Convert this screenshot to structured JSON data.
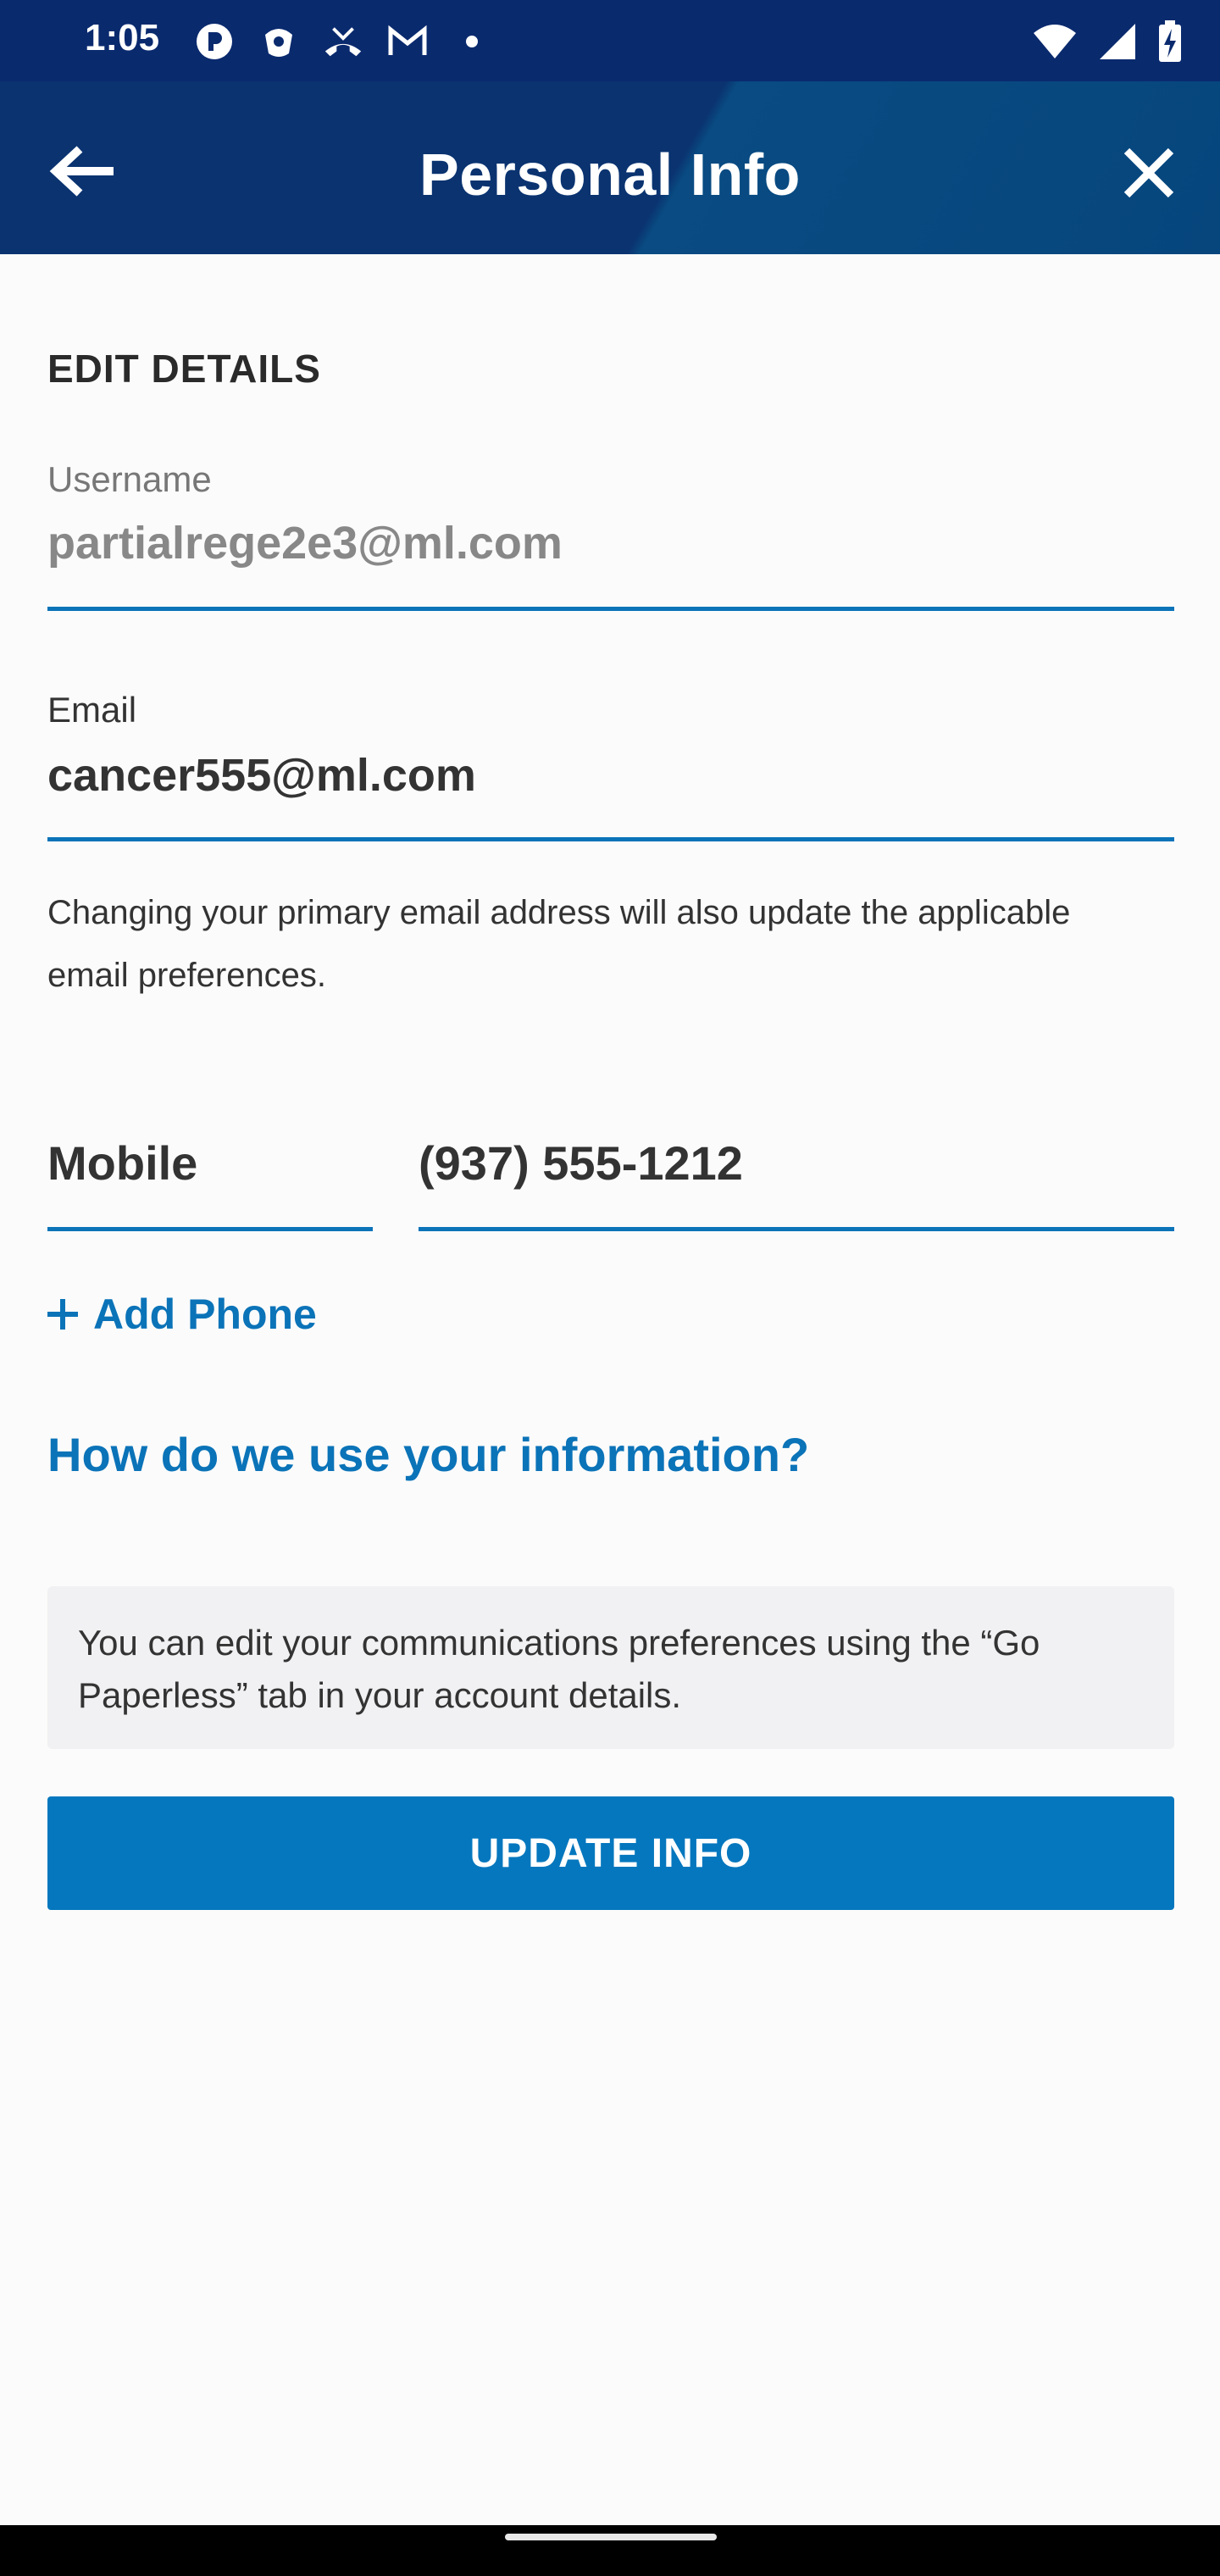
{
  "status_bar": {
    "time": "1:05",
    "left_icons": [
      "pandora-icon",
      "shield-app-icon",
      "missed-call-icon",
      "gmail-icon",
      "dot-icon"
    ],
    "right_icons": [
      "wifi-icon",
      "signal-icon",
      "battery-charging-icon"
    ]
  },
  "header": {
    "title": "Personal Info",
    "background": "#0a3370"
  },
  "form": {
    "section_title": "EDIT DETAILS",
    "username": {
      "label": "Username",
      "value": "partialrege2e3@ml.com"
    },
    "email": {
      "label": "Email",
      "value": "cancer555@ml.com",
      "help": "Changing your primary email address will also update the applicable email preferences."
    },
    "phone": {
      "type": "Mobile",
      "number": "(937) 555-1212"
    },
    "add_phone_label": "Add Phone",
    "info_link": "How do we use your information?",
    "notice": "You can edit your communications preferences using the “Go Paperless” tab in your account details.",
    "submit_label": "UPDATE INFO"
  },
  "colors": {
    "accent": "#0b73b8",
    "button": "#0577be",
    "status_bar": "#0a2a6e"
  }
}
